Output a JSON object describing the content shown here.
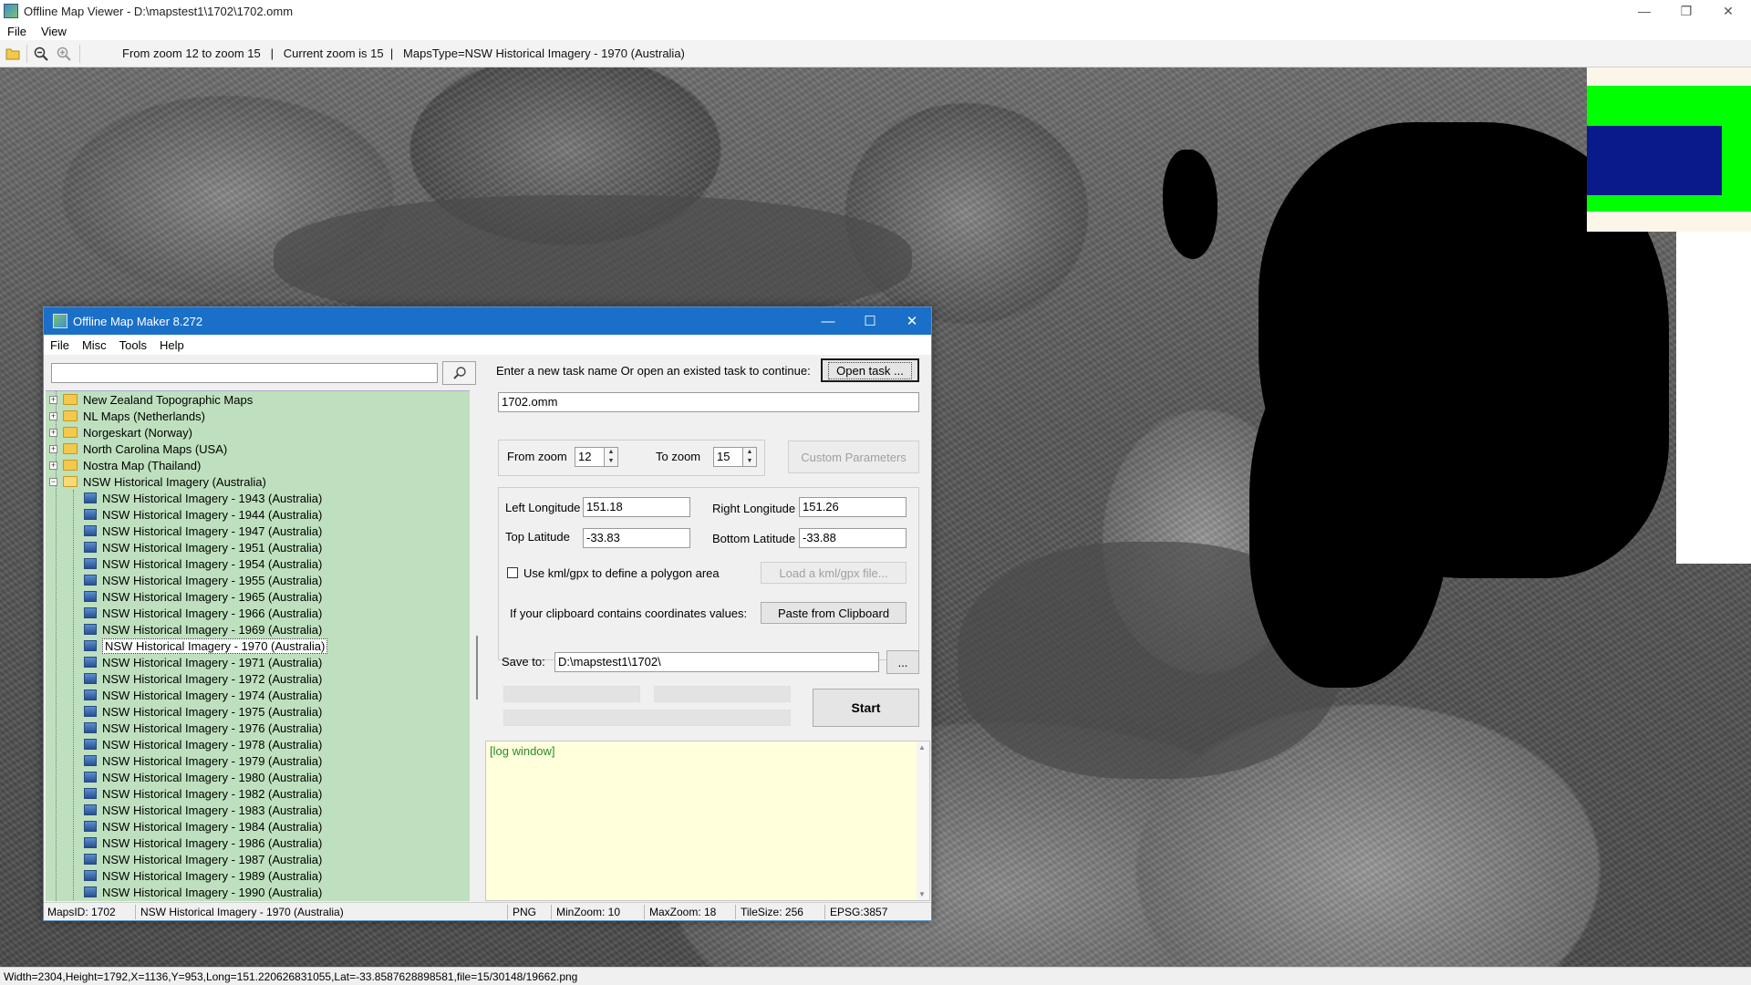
{
  "viewer": {
    "title": "Offline Map Viewer - D:\\mapstest1\\1702\\1702.omm",
    "menu": [
      "File",
      "View"
    ],
    "toolbar_status": "From zoom 12 to zoom 15   |   Current zoom is 15  |   MapsType=NSW Historical Imagery - 1970 (Australia)",
    "bottom_status": "Width=2304,Height=1792,X=1136,Y=953,Long=151.220626831055,Lat=-33.8587628898581,file=15/30148/19662.png",
    "controls": {
      "minimize": "—",
      "restore": "❐",
      "close": "✕"
    }
  },
  "dialog": {
    "title": "Offline Map Maker 8.272",
    "menu": [
      "File",
      "Misc",
      "Tools",
      "Help"
    ],
    "controls": {
      "minimize": "—",
      "maximize": "☐",
      "close": "✕"
    },
    "search": {
      "placeholder": "",
      "button_icon": "magnifier"
    },
    "tree": {
      "folders": [
        {
          "label": "New Zealand Topographic Maps",
          "expanded": false
        },
        {
          "label": "NL Maps (Netherlands)",
          "expanded": false
        },
        {
          "label": "Norgeskart (Norway)",
          "expanded": false
        },
        {
          "label": "North Carolina Maps (USA)",
          "expanded": false
        },
        {
          "label": "Nostra Map (Thailand)",
          "expanded": false
        },
        {
          "label": "NSW Historical Imagery (Australia)",
          "expanded": true
        }
      ],
      "children": [
        "NSW Historical Imagery - 1943 (Australia)",
        "NSW Historical Imagery - 1944 (Australia)",
        "NSW Historical Imagery - 1947 (Australia)",
        "NSW Historical Imagery - 1951 (Australia)",
        "NSW Historical Imagery - 1954 (Australia)",
        "NSW Historical Imagery - 1955 (Australia)",
        "NSW Historical Imagery - 1965 (Australia)",
        "NSW Historical Imagery - 1966 (Australia)",
        "NSW Historical Imagery - 1969 (Australia)",
        "NSW Historical Imagery - 1970 (Australia)",
        "NSW Historical Imagery - 1971 (Australia)",
        "NSW Historical Imagery - 1972 (Australia)",
        "NSW Historical Imagery - 1974 (Australia)",
        "NSW Historical Imagery - 1975 (Australia)",
        "NSW Historical Imagery - 1976 (Australia)",
        "NSW Historical Imagery - 1978 (Australia)",
        "NSW Historical Imagery - 1979 (Australia)",
        "NSW Historical Imagery - 1980 (Australia)",
        "NSW Historical Imagery - 1982 (Australia)",
        "NSW Historical Imagery - 1983 (Australia)",
        "NSW Historical Imagery - 1984 (Australia)",
        "NSW Historical Imagery - 1986 (Australia)",
        "NSW Historical Imagery - 1987 (Australia)",
        "NSW Historical Imagery - 1989 (Australia)",
        "NSW Historical Imagery - 1990 (Australia)"
      ],
      "selected": "NSW Historical Imagery - 1970 (Australia)"
    },
    "task": {
      "prompt": "Enter a new task name Or open an existed task to continue:",
      "open_button": "Open task ...",
      "name_value": "1702.omm"
    },
    "zoom": {
      "from_label": "From zoom",
      "from_value": "12",
      "to_label": "To zoom",
      "to_value": "15",
      "custom_button": "Custom Parameters"
    },
    "coords": {
      "left_lon_label": "Left Longitude",
      "left_lon_value": "151.18",
      "right_lon_label": "Right Longitude",
      "right_lon_value": "151.26",
      "top_lat_label": "Top Latitude",
      "top_lat_value": "-33.83",
      "bottom_lat_label": "Bottom Latitude",
      "bottom_lat_value": "-33.88",
      "kml_label": "Use kml/gpx to define a polygon area",
      "kml_button": "Load a kml/gpx file...",
      "clipboard_label": "If your clipboard contains coordinates values:",
      "clipboard_button": "Paste from Clipboard"
    },
    "save": {
      "label": "Save to:",
      "value": "D:\\mapstest1\\1702\\",
      "browse_button": "...",
      "start_button": "Start"
    },
    "log": {
      "text": "[log window]"
    },
    "status": {
      "maps_id": "MapsID: 1702",
      "maps_name": "NSW Historical Imagery - 1970 (Australia)",
      "format": "PNG",
      "min_zoom": "MinZoom: 10",
      "max_zoom": "MaxZoom: 18",
      "tile_size": "TileSize: 256",
      "epsg": "EPSG:3857"
    }
  }
}
